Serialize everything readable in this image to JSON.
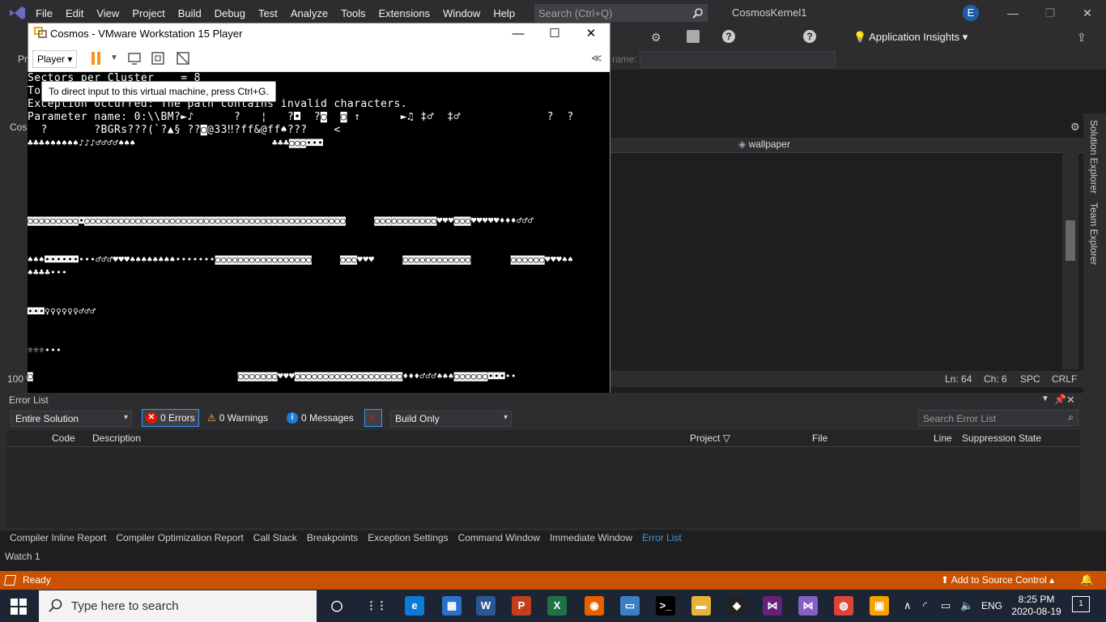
{
  "vs": {
    "menu": [
      "File",
      "Edit",
      "View",
      "Project",
      "Build",
      "Debug",
      "Test",
      "Analyze",
      "Tools",
      "Extensions",
      "Window",
      "Help"
    ],
    "search_placeholder": "Search (Ctrl+Q)",
    "solution_name": "CosmosKernel1",
    "user_initial": "E",
    "app_insights": "Application Insights",
    "frame_label": "rame:",
    "left_fragments": [
      "Pr",
      "Cos"
    ],
    "zoom": "100 %",
    "nav_item": "wallpaper",
    "status": {
      "ln": "Ln: 64",
      "ch": "Ch: 6",
      "spc": "SPC",
      "crlf": "CRLF"
    },
    "side_tabs": [
      "Solution Explorer",
      "Team Explorer"
    ],
    "accent": "#ca5100"
  },
  "vmware": {
    "title": "Cosmos - VMware Workstation 15 Player",
    "player_label": "Player",
    "tooltip": "To direct input to this virtual machine, press Ctrl+G.",
    "console_lines": [
      "Sectors per Cluster    = 8",
      "To",
      "Exception occurred: The path contains invalid characters.",
      "Parameter name: 0:\\\\BM?►♪      ?   ¦   ?◘  ?◙  ◙ ↑      ►♫ ‡♂  ‡♂             ?  ?",
      "  ?       ?BGRs???(`?▲§ ??◙@33‼?ff&@ff♠???    <",
      "♣♣♣♠♠♠♠♠♠♪♪♪♂♂♂♂♠♠♠                        ♣♣♣◙◙◙◘◘◘",
      "◙◙◙◙◙◙◙◙◙◘◙◙◙◙◙◙◙◙◙◙◙◙◙◙◙◙◙◙◙◙◙◙◙◙◙◙◙◙◙◙◙◙◙◙◙◙◙◙◙◙◙◙◙◙◙◙     ◙◙◙◙◙◙◙◙◙◙◙♥♥♥◙◙◙♥♥♥♥♥♦♦♦♂♂♂",
      "♠♠♠◘◘◘◘◘◘•••♂♂♂♥♥♥♠♠♠♠♠♠♠♠•••••••◙◙◙◙◙◙◙◙◙◙◙◙◙◙◙◙◙     ◙◙◙♥♥♥     ◙◙◙◙◙◙◙◙◙◙◙◙       ◙◙◙◙◙◙♥♥♥♠♠",
      "♠♣♣♣•••",
      "◘◘◘♀♀♀♀♀♀♂♂♂",
      "☼☼☼•••",
      "◙                                    ◙◙◙◙◙◙◙♥♥♥◙◙◙◙◙◙◙◙◙◙◙◙◙◙◙◙◙◙◙♦♦♦♂♂♂♠♠♠◙◙◙◙◙◙◘◘◘••"
    ]
  },
  "error_list": {
    "title": "Error List",
    "scope": "Entire Solution",
    "errors": "0 Errors",
    "warnings": "0 Warnings",
    "messages": "0 Messages",
    "build_filter": "Build Only",
    "search_placeholder": "Search Error List",
    "columns": [
      "Code",
      "Description",
      "Project",
      "File",
      "Line",
      "Suppression State"
    ]
  },
  "bottom_tabs": [
    "Compiler Inline Report",
    "Compiler Optimization Report",
    "Call Stack",
    "Breakpoints",
    "Exception Settings",
    "Command Window",
    "Immediate Window",
    "Error List"
  ],
  "active_tab": "Error List",
  "watch_tab": "Watch 1",
  "statusbar": {
    "ready": "Ready",
    "source_control": "Add to Source Control"
  },
  "taskbar": {
    "search_placeholder": "Type here to search",
    "lang": "ENG",
    "time": "8:25 PM",
    "date": "2020-08-19",
    "apps": [
      {
        "name": "task-view-icon",
        "color": "#1b2533",
        "glyph": "◯"
      },
      {
        "name": "timeline-icon",
        "color": "#1b2533",
        "glyph": "⋮⋮"
      },
      {
        "name": "edge-icon",
        "color": "#0c7bd6",
        "glyph": "e"
      },
      {
        "name": "store-icon",
        "color": "#2a71c9",
        "glyph": "▦"
      },
      {
        "name": "word-icon",
        "color": "#2b5797",
        "glyph": "W"
      },
      {
        "name": "powerpoint-icon",
        "color": "#c43e1c",
        "glyph": "P"
      },
      {
        "name": "excel-icon",
        "color": "#1f7244",
        "glyph": "X"
      },
      {
        "name": "firefox-icon",
        "color": "#e66000",
        "glyph": "◉"
      },
      {
        "name": "desktop-icon",
        "color": "#3c7fc5",
        "glyph": "▭"
      },
      {
        "name": "terminal-icon",
        "color": "#000000",
        "glyph": ">_"
      },
      {
        "name": "explorer-icon",
        "color": "#e8b33a",
        "glyph": "▬"
      },
      {
        "name": "unity-icon",
        "color": "#222222",
        "glyph": "◆"
      },
      {
        "name": "vs-icon",
        "color": "#68217a",
        "glyph": "⋈"
      },
      {
        "name": "vs-preview-icon",
        "color": "#865fc5",
        "glyph": "⋈"
      },
      {
        "name": "chrome-icon",
        "color": "#db4437",
        "glyph": "◍"
      },
      {
        "name": "vmware-icon",
        "color": "#f4a300",
        "glyph": "▣"
      }
    ]
  }
}
